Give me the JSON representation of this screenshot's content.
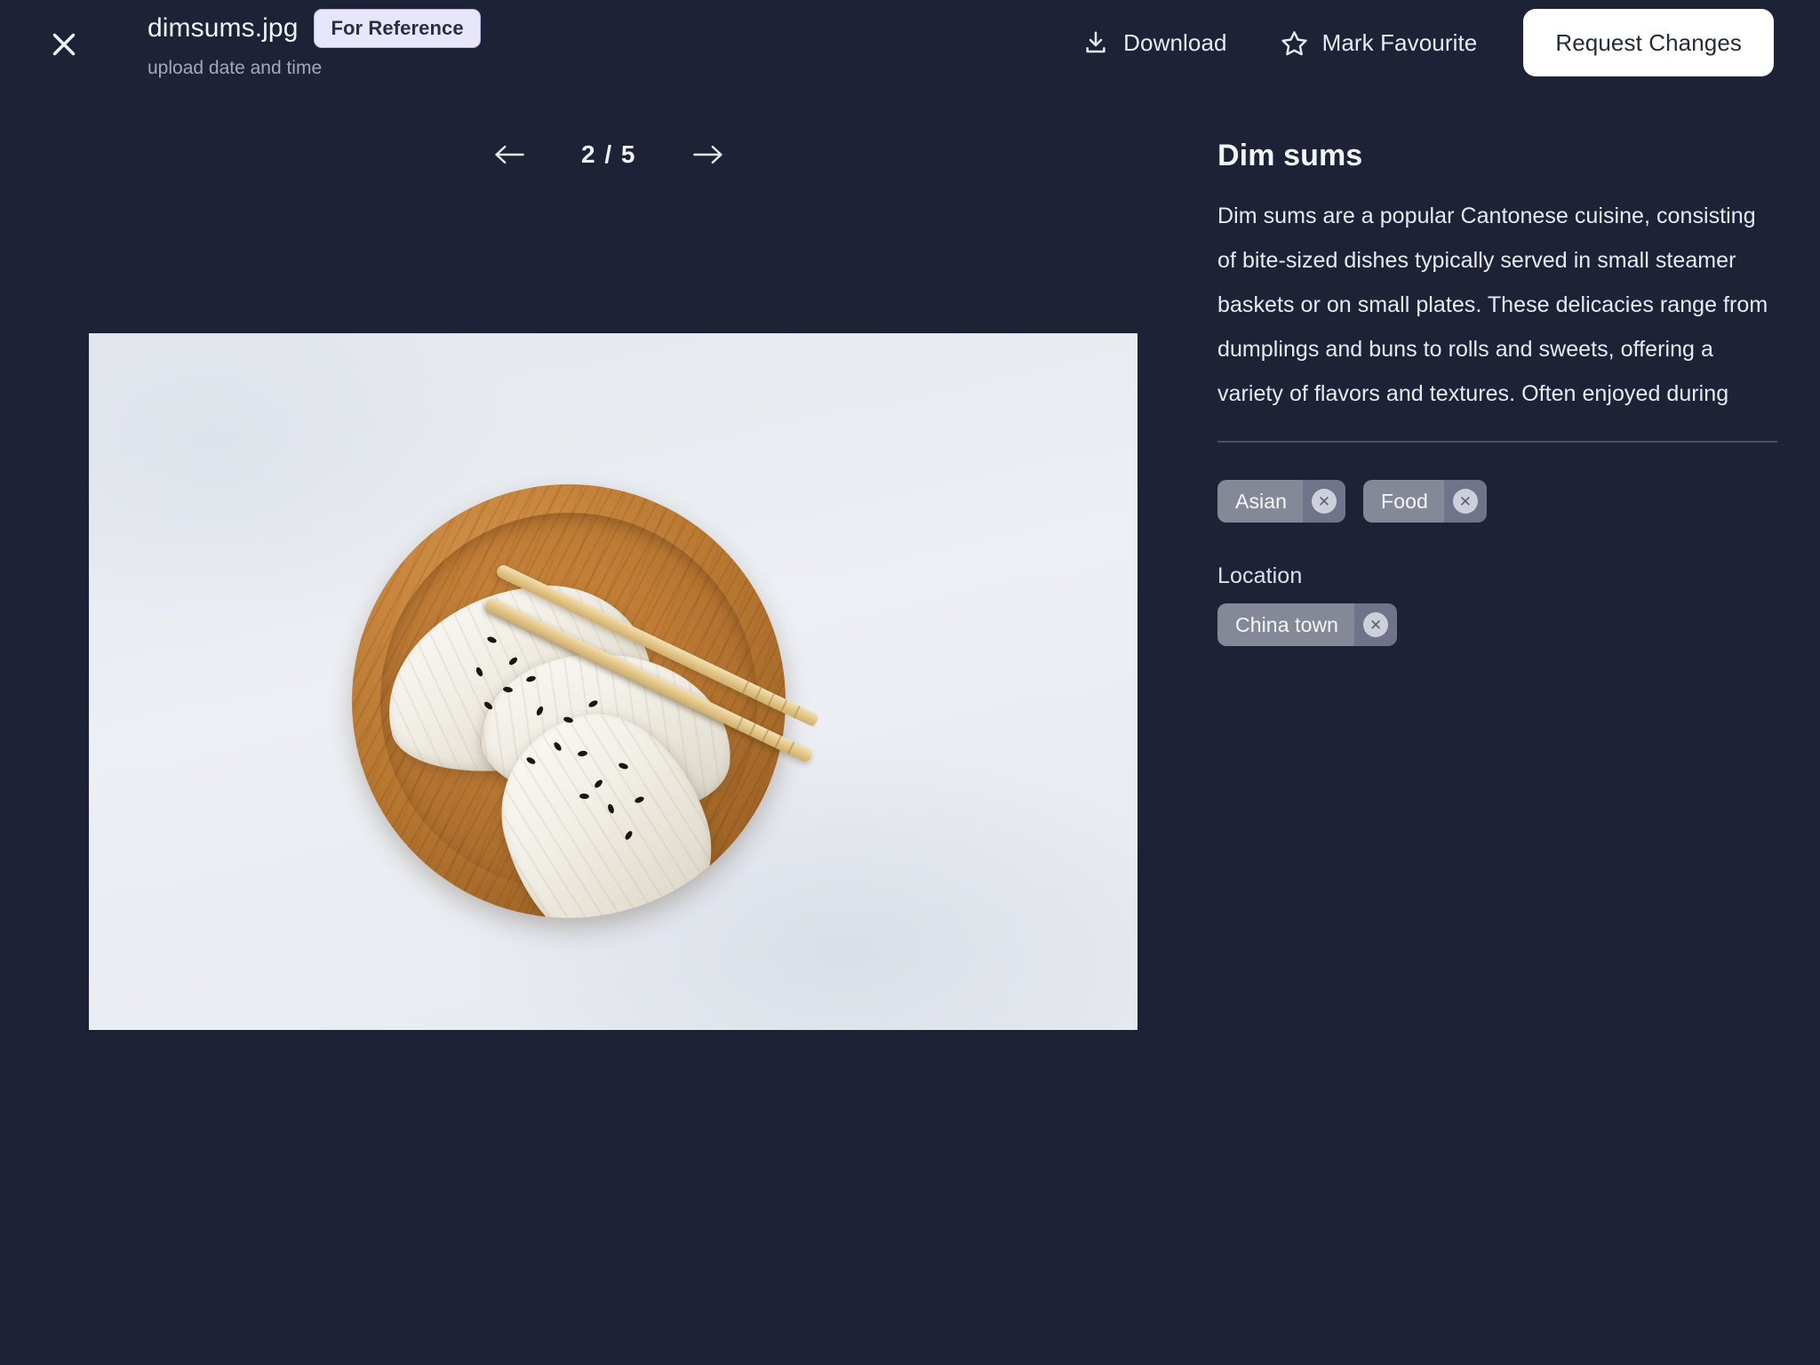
{
  "header": {
    "close_icon": "close-icon",
    "file_name": "dimsums.jpg",
    "reference_badge": "For Reference",
    "upload_date": "upload date and time",
    "download_label": "Download",
    "download_icon": "download-icon",
    "favourite_label": "Mark Favourite",
    "favourite_icon": "star-icon",
    "request_changes_label": "Request Changes"
  },
  "viewer": {
    "prev_icon": "arrow-left-icon",
    "next_icon": "arrow-right-icon",
    "page_indicator": "2 / 5",
    "current_page": 2,
    "total_pages": 5,
    "image_alt": "Three dumplings topped with black sesame seeds in a round wooden bowl with bamboo chopsticks resting across the rim"
  },
  "detail": {
    "title": "Dim sums",
    "description": "Dim sums are a popular Cantonese cuisine, consisting of bite-sized dishes typically served in small steamer baskets or on small plates. These delicacies range from dumplings and buns to rolls and sweets, offering a variety of flavors and textures. Often enjoyed during",
    "tags": [
      {
        "label": "Asian",
        "remove_icon": "close-icon"
      },
      {
        "label": "Food",
        "remove_icon": "close-icon"
      }
    ],
    "location_label": "Location",
    "locations": [
      {
        "label": "China town",
        "remove_icon": "close-icon"
      }
    ]
  },
  "colors": {
    "background": "#1d2236",
    "badge_background": "#e7e6fb",
    "badge_text": "#2b2f44",
    "primary_button_background": "#ffffff",
    "primary_button_text": "#262b3d",
    "chip_background": "#858997",
    "chip_remove_background": "#70748a",
    "divider": "#4b5066",
    "muted_text": "#a2a8bd"
  }
}
